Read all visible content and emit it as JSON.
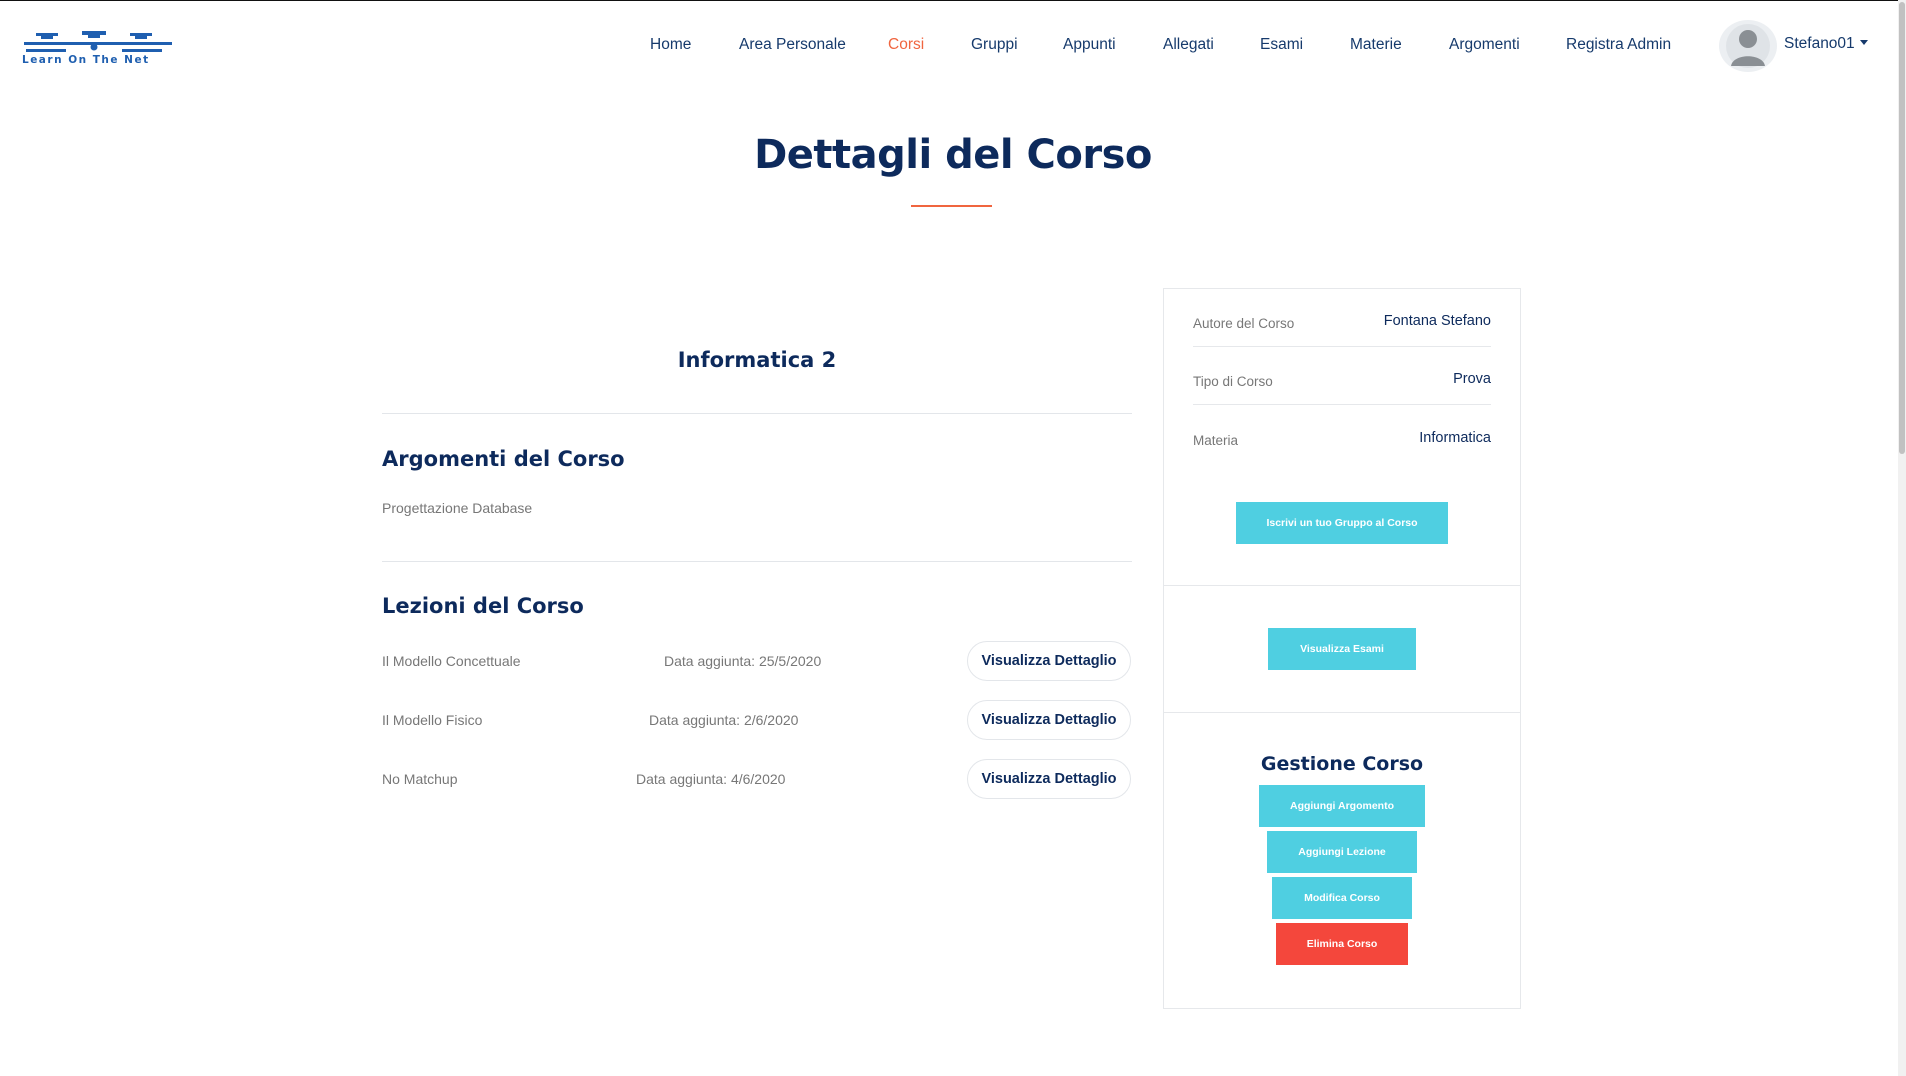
{
  "header": {
    "logo_text": "Learn On The Net",
    "nav": [
      {
        "label": "Home",
        "active": false
      },
      {
        "label": "Area Personale",
        "active": false
      },
      {
        "label": "Corsi",
        "active": true
      },
      {
        "label": "Gruppi",
        "active": false
      },
      {
        "label": "Appunti",
        "active": false
      },
      {
        "label": "Allegati",
        "active": false
      },
      {
        "label": "Esami",
        "active": false
      },
      {
        "label": "Materie",
        "active": false
      },
      {
        "label": "Argomenti",
        "active": false
      },
      {
        "label": "Registra Admin",
        "active": false
      }
    ],
    "user": {
      "name": "Stefano01",
      "avatar_icon": "user-silhouette-icon",
      "menu_icon": "caret-down-icon"
    }
  },
  "page": {
    "title": "Dettagli del Corso"
  },
  "course": {
    "name": "Informatica 2",
    "topics_title": "Argomenti del Corso",
    "topics": [
      "Progettazione Database"
    ],
    "lessons_title": "Lezioni del Corso",
    "lessons": [
      {
        "name": "Il Modello Concettuale",
        "date": "Data aggiunta: 25/5/2020",
        "button": "Visualizza Dettaglio"
      },
      {
        "name": "Il Modello Fisico",
        "date": "Data aggiunta: 2/6/2020",
        "button": "Visualizza Dettaglio"
      },
      {
        "name": "No Matchup",
        "date": "Data aggiunta: 4/6/2020",
        "button": "Visualizza Dettaglio"
      }
    ]
  },
  "sidebar": {
    "info": [
      {
        "label": "Autore del Corso",
        "value": "Fontana Stefano"
      },
      {
        "label": "Tipo di Corso",
        "value": "Prova"
      },
      {
        "label": "Materia",
        "value": "Informatica"
      }
    ],
    "enroll_button": "Iscrivi un tuo Gruppo al Corso",
    "exams_button": "Visualizza Esami",
    "manage": {
      "title": "Gestione Corso",
      "add_topic": "Aggiungi Argomento",
      "add_lesson": "Aggiungi Lezione",
      "edit_course": "Modifica Corso",
      "delete_course": "Elimina Corso"
    }
  },
  "colors": {
    "accent": "#f0653f",
    "primary_text": "#0d2a5c",
    "button_cyan": "#4fcfe1",
    "button_danger": "#f4473c"
  }
}
